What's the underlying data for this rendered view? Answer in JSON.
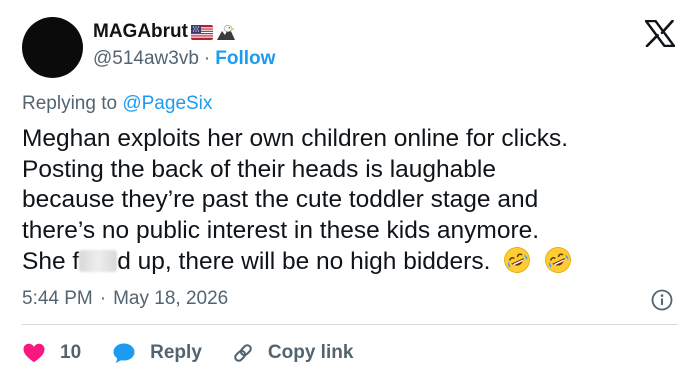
{
  "user": {
    "display_name": "MAGAbrut",
    "handle": "@514aw3vb",
    "separator": "·",
    "follow_label": "Follow",
    "badges": [
      "us-flag-emoji",
      "eagle-emoji"
    ]
  },
  "replying": {
    "prefix": "Replying to ",
    "mention": "@PageSix"
  },
  "tweet": {
    "lines": [
      "Meghan exploits her own children online for clicks.",
      "Posting the back of their heads is laughable",
      "because they’re past the cute toddler stage and",
      "there’s no public interest in these kids anymore."
    ],
    "last_line_start": "She f",
    "last_line_end": "d up, there will be no high bidders.",
    "emojis": [
      "rolling-on-floor-laughing-emoji",
      "rolling-on-floor-laughing-emoji"
    ]
  },
  "meta": {
    "time": "5:44 PM",
    "separator": "·",
    "date": "May 18, 2026"
  },
  "actions": {
    "like_count": "10",
    "reply_label": "Reply",
    "copy_link_label": "Copy link"
  },
  "colors": {
    "accent": "#1d9bf0",
    "secondary_text": "#536471",
    "like": "#f91880",
    "divider": "#cfd9de"
  }
}
